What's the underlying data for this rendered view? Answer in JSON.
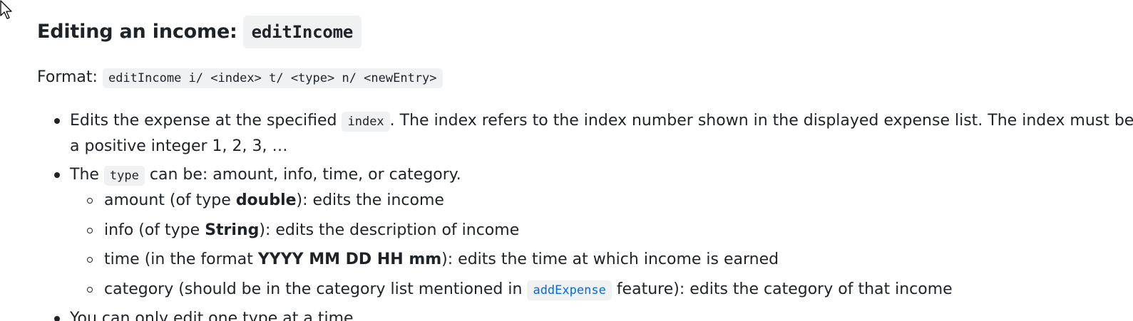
{
  "heading": {
    "text": "Editing an income:",
    "code": "editIncome"
  },
  "format": {
    "label": "Format:",
    "code": "editIncome i/ <index> t/ <type> n/ <newEntry>"
  },
  "bullet1": {
    "pre": "Edits the expense at the specified",
    "code": "index",
    "post": ". The index refers to the index number shown in the displayed expense list. The index must be",
    "line2": "a positive integer 1, 2, 3, …"
  },
  "bullet2": {
    "pre": "The",
    "code": "type",
    "post": "can be: amount, info, time, or category."
  },
  "sub1": {
    "pre": "amount (of type ",
    "bold": "double",
    "post": "): edits the income"
  },
  "sub2": {
    "pre": "info (of type ",
    "bold": "String",
    "post": "): edits the description of income"
  },
  "sub3": {
    "pre": "time (in the format ",
    "bold": "YYYY MM DD HH mm",
    "post": "): edits the time at which income is earned"
  },
  "sub4": {
    "pre": "category (should be in the category list mentioned in",
    "code": "addExpense",
    "post": "feature): edits the category of that income"
  },
  "bullet3": {
    "text": "You can only edit one type at a time."
  }
}
